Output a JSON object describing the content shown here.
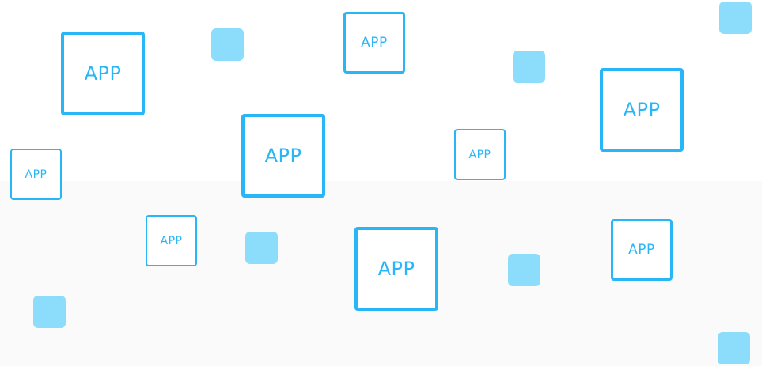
{
  "label": "APP",
  "colors": {
    "accent": "#29b6f6",
    "tile": "#8cdcfc",
    "background": "#ffffff",
    "band": "#fafafa"
  }
}
